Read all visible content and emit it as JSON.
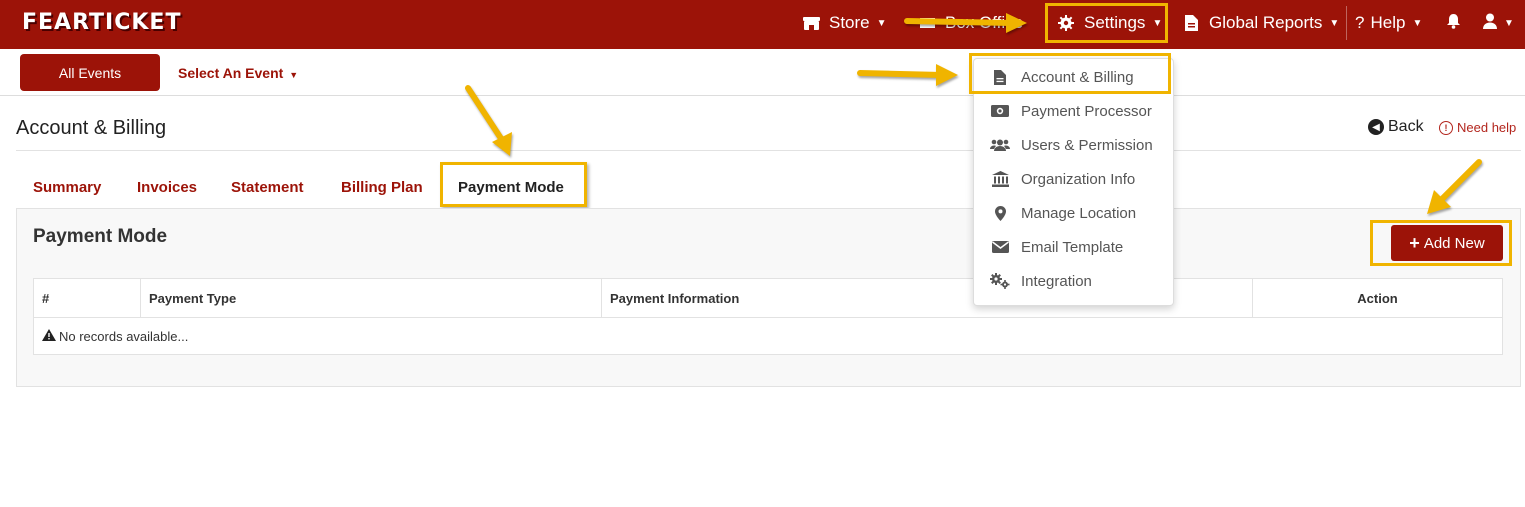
{
  "brand": {
    "logo_text": "FEARTICKET"
  },
  "navbar": {
    "store_label": "Store",
    "box_office_label": "Box Office",
    "settings_label": "Settings",
    "global_reports_label": "Global Reports",
    "help_label": "Help"
  },
  "subnav": {
    "all_events_label": "All Events",
    "select_event_label": "Select An Event"
  },
  "header": {
    "title": "Account & Billing",
    "back_label": "Back",
    "need_help_label": "Need help"
  },
  "tabs": [
    {
      "label": "Summary"
    },
    {
      "label": "Invoices"
    },
    {
      "label": "Statement"
    },
    {
      "label": "Billing Plan"
    },
    {
      "label": "Payment Mode",
      "active": true
    }
  ],
  "panel": {
    "title": "Payment Mode",
    "add_new_label": "Add New",
    "table": {
      "columns": [
        "#",
        "Payment Type",
        "Payment Information",
        "Action"
      ],
      "empty_message": "No records available..."
    }
  },
  "settings_menu": {
    "items": [
      {
        "label": "Account & Billing",
        "icon": "file-icon"
      },
      {
        "label": "Payment Processor",
        "icon": "money-icon"
      },
      {
        "label": "Users & Permission",
        "icon": "users-icon"
      },
      {
        "label": "Organization Info",
        "icon": "bank-icon"
      },
      {
        "label": "Manage Location",
        "icon": "map-marker-icon"
      },
      {
        "label": "Email Template",
        "icon": "envelope-icon"
      },
      {
        "label": "Integration",
        "icon": "cogs-icon"
      }
    ]
  },
  "colors": {
    "brand_red": "#9c1308",
    "highlight_yellow": "#f0b400",
    "panel_bg": "#f8f8f8"
  }
}
